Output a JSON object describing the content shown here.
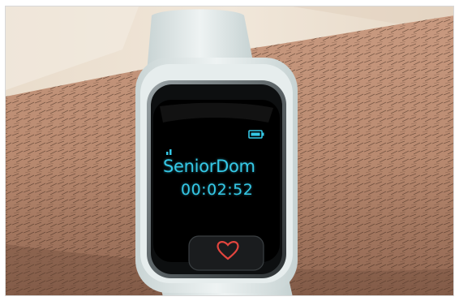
{
  "watch": {
    "device_name": "SeniorDom",
    "timer": "00:02:52",
    "screen_text_color": "#35c8e6",
    "strap_color": "#dfe8e8",
    "icons": {
      "signal": "signal-bars-icon",
      "battery": "battery-icon",
      "sos_button": "heart-icon"
    }
  }
}
